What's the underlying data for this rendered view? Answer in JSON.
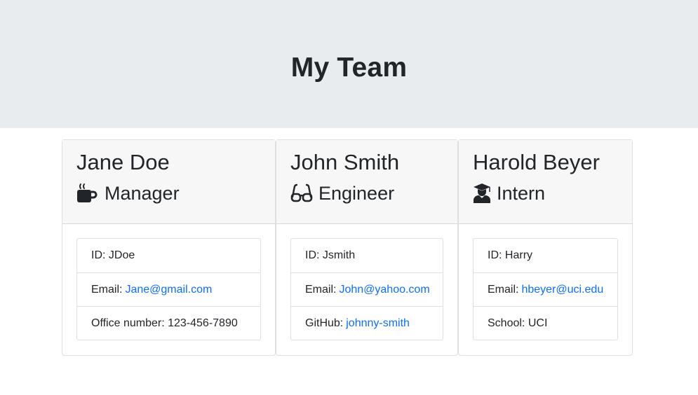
{
  "header": {
    "title": "My Team"
  },
  "team": [
    {
      "name": "Jane Doe",
      "role": "Manager",
      "icon": "coffee-mug-icon",
      "id_label": "ID:",
      "id_value": "JDoe",
      "email_label": "Email:",
      "email_value": "Jane@gmail.com",
      "extra_label": "Office number:",
      "extra_value": "123-456-7890"
    },
    {
      "name": "John Smith",
      "role": "Engineer",
      "icon": "glasses-icon",
      "id_label": "ID:",
      "id_value": "Jsmith",
      "email_label": "Email:",
      "email_value": "John@yahoo.com",
      "extra_label": "GitHub:",
      "extra_value": "johnny-smith"
    },
    {
      "name": "Harold Beyer",
      "role": "Intern",
      "icon": "graduate-icon",
      "id_label": "ID:",
      "id_value": "Harry",
      "email_label": "Email:",
      "email_value": "hbeyer@uci.edu",
      "extra_label": "School:",
      "extra_value": "UCI"
    }
  ],
  "colors": {
    "link": "#0d6efd",
    "jumbotron": "#e9ecef",
    "header_bg": "#f7f7f7"
  }
}
